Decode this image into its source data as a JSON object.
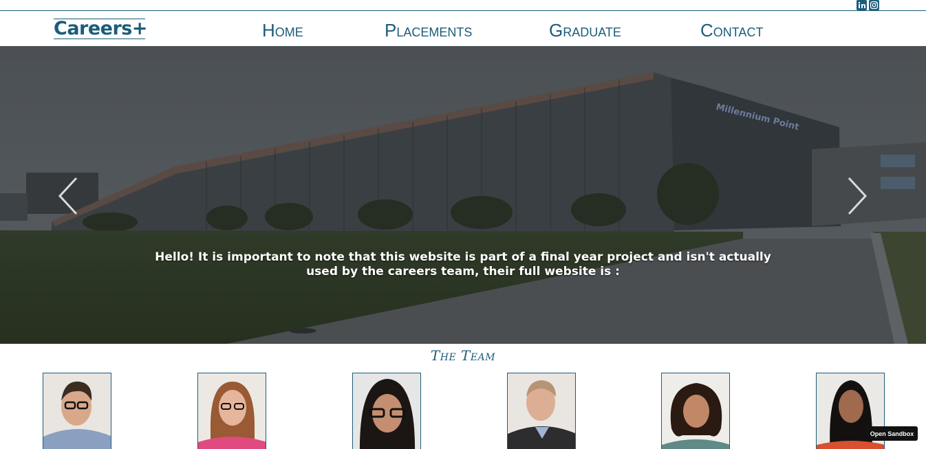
{
  "brand": {
    "logo_text": "Careers+"
  },
  "social": {
    "icons": [
      "linkedin-icon",
      "instagram-icon"
    ],
    "color": "#1b5c7a"
  },
  "nav": {
    "items": [
      "Home",
      "Placements",
      "Graduate",
      "Contact"
    ]
  },
  "hero": {
    "message": "Hello! It is important to note that this website is part of a final year project and isn't actually used by the careers team, their full website is :",
    "building_sign": "Millennium Point"
  },
  "team": {
    "title": "The Team",
    "member_count": 6
  },
  "sandbox": {
    "label": "Open Sandbox"
  },
  "colors": {
    "accent": "#1b5c7a",
    "overlay": "#3c4245"
  }
}
